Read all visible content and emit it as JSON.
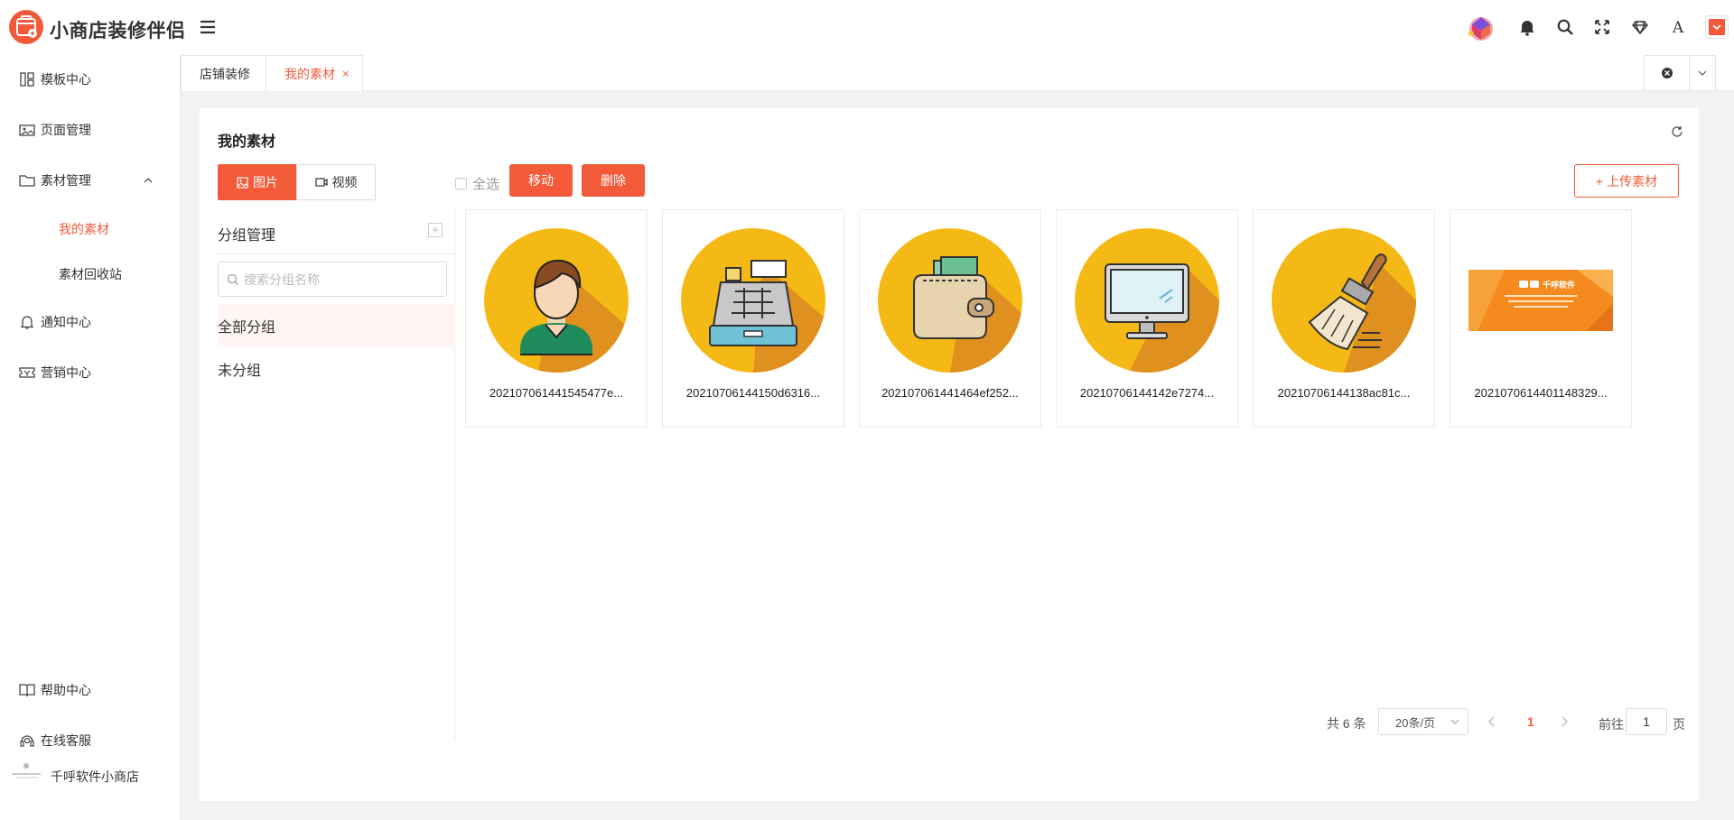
{
  "app": {
    "title": "小商店装修伴侣"
  },
  "header": {
    "icons": [
      "avatar-icon",
      "bell-icon",
      "search-icon",
      "fullscreen-icon",
      "diamond-icon",
      "font-icon",
      "dropdown-icon"
    ]
  },
  "sidebar": {
    "items": [
      {
        "label": "模板中心",
        "icon": "template-icon"
      },
      {
        "label": "页面管理",
        "icon": "page-icon"
      },
      {
        "label": "素材管理",
        "icon": "folder-icon",
        "expanded": true,
        "children": [
          {
            "label": "我的素材",
            "active": true
          },
          {
            "label": "素材回收站",
            "active": false
          }
        ]
      },
      {
        "label": "通知中心",
        "icon": "bell-icon"
      },
      {
        "label": "营销中心",
        "icon": "ticket-icon"
      }
    ],
    "bottom": [
      {
        "label": "帮助中心",
        "icon": "book-icon"
      },
      {
        "label": "在线客服",
        "icon": "headset-icon"
      }
    ],
    "shop_name": "千呼软件小商店"
  },
  "tabs": [
    {
      "label": "店铺装修",
      "active": false
    },
    {
      "label": "我的素材",
      "active": true,
      "close": "×"
    }
  ],
  "main": {
    "title": "我的素材",
    "type_buttons": {
      "image": "图片",
      "video": "视频"
    },
    "select_all": "全选",
    "move": "移动",
    "delete": "删除",
    "upload": "上传素材",
    "upload_prefix": "+"
  },
  "groups": {
    "title": "分组管理",
    "add": "+",
    "search_placeholder": "搜索分组名称",
    "items": [
      {
        "label": "全部分组",
        "active": true
      },
      {
        "label": "未分组",
        "active": false
      }
    ]
  },
  "materials": [
    {
      "name": "20210706144154547​7e...",
      "icon": "person-icon"
    },
    {
      "name": "20210706144150d6316...",
      "icon": "cash-register-icon"
    },
    {
      "name": "20210706144146​4ef252...",
      "icon": "wallet-icon"
    },
    {
      "name": "20210706144142e7274...",
      "icon": "monitor-icon"
    },
    {
      "name": "20210706144138ac81c...",
      "icon": "brush-icon"
    },
    {
      "name": "20210706144011483​29...",
      "icon": "banner-image-icon",
      "banner_brand": "千呼软件"
    }
  ],
  "pagination": {
    "total": "共 6 条",
    "page_size": "20条/页",
    "current": "1",
    "goto_label": "前往",
    "goto_value": "1",
    "page_suffix": "页"
  },
  "colors": {
    "accent": "#f25a3a",
    "coin_yellow": "#f5b915",
    "coin_shadow": "#e0901e"
  }
}
